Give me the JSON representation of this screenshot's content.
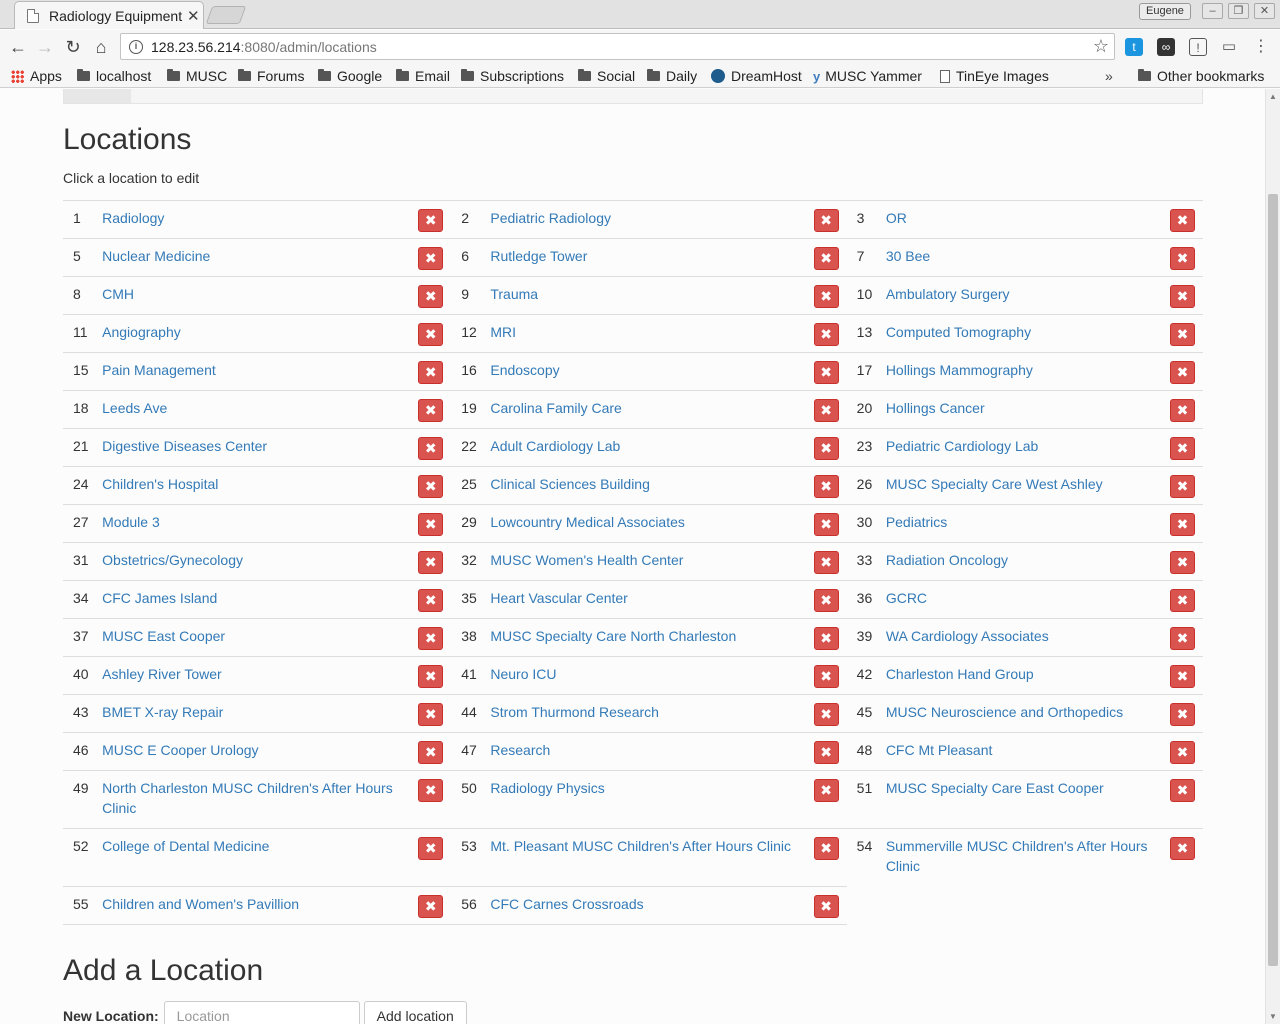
{
  "browser": {
    "tab_title": "Radiology Equipment",
    "profile_name": "Eugene",
    "url_host": "128.23.56.214",
    "url_rest": ":8080/admin/locations",
    "bookmarks": [
      "Apps",
      "localhost",
      "MUSC",
      "Forums",
      "Google",
      "Email",
      "Subscriptions",
      "Social",
      "Daily",
      "DreamHost",
      "MUSC Yammer",
      "TinEye Images"
    ],
    "other_bookmarks": "Other bookmarks",
    "overflow": "»"
  },
  "page": {
    "title": "Locations",
    "subtitle": "Click a location to edit",
    "delete_glyph": "✖",
    "rows": [
      [
        {
          "id": "1",
          "name": "Radiology"
        },
        {
          "id": "2",
          "name": "Pediatric Radiology"
        },
        {
          "id": "3",
          "name": "OR"
        }
      ],
      [
        {
          "id": "5",
          "name": "Nuclear Medicine"
        },
        {
          "id": "6",
          "name": "Rutledge Tower"
        },
        {
          "id": "7",
          "name": "30 Bee"
        }
      ],
      [
        {
          "id": "8",
          "name": "CMH"
        },
        {
          "id": "9",
          "name": "Trauma"
        },
        {
          "id": "10",
          "name": "Ambulatory Surgery"
        }
      ],
      [
        {
          "id": "11",
          "name": "Angiography"
        },
        {
          "id": "12",
          "name": "MRI"
        },
        {
          "id": "13",
          "name": "Computed Tomography"
        }
      ],
      [
        {
          "id": "15",
          "name": "Pain Management"
        },
        {
          "id": "16",
          "name": "Endoscopy"
        },
        {
          "id": "17",
          "name": "Hollings Mammography"
        }
      ],
      [
        {
          "id": "18",
          "name": "Leeds Ave"
        },
        {
          "id": "19",
          "name": "Carolina Family Care"
        },
        {
          "id": "20",
          "name": "Hollings Cancer"
        }
      ],
      [
        {
          "id": "21",
          "name": "Digestive Diseases Center"
        },
        {
          "id": "22",
          "name": "Adult Cardiology Lab"
        },
        {
          "id": "23",
          "name": "Pediatric Cardiology Lab"
        }
      ],
      [
        {
          "id": "24",
          "name": "Children's Hospital"
        },
        {
          "id": "25",
          "name": "Clinical Sciences Building"
        },
        {
          "id": "26",
          "name": "MUSC Specialty Care West Ashley"
        }
      ],
      [
        {
          "id": "27",
          "name": "Module 3"
        },
        {
          "id": "29",
          "name": "Lowcountry Medical Associates"
        },
        {
          "id": "30",
          "name": "Pediatrics"
        }
      ],
      [
        {
          "id": "31",
          "name": "Obstetrics/Gynecology"
        },
        {
          "id": "32",
          "name": "MUSC Women's Health Center"
        },
        {
          "id": "33",
          "name": "Radiation Oncology"
        }
      ],
      [
        {
          "id": "34",
          "name": "CFC James Island"
        },
        {
          "id": "35",
          "name": "Heart Vascular Center"
        },
        {
          "id": "36",
          "name": "GCRC"
        }
      ],
      [
        {
          "id": "37",
          "name": "MUSC East Cooper"
        },
        {
          "id": "38",
          "name": "MUSC Specialty Care North Charleston"
        },
        {
          "id": "39",
          "name": "WA Cardiology Associates"
        }
      ],
      [
        {
          "id": "40",
          "name": "Ashley River Tower"
        },
        {
          "id": "41",
          "name": "Neuro ICU"
        },
        {
          "id": "42",
          "name": "Charleston Hand Group"
        }
      ],
      [
        {
          "id": "43",
          "name": "BMET X-ray Repair"
        },
        {
          "id": "44",
          "name": "Strom Thurmond Research"
        },
        {
          "id": "45",
          "name": "MUSC Neuroscience and Orthopedics"
        }
      ],
      [
        {
          "id": "46",
          "name": "MUSC E Cooper Urology"
        },
        {
          "id": "47",
          "name": "Research"
        },
        {
          "id": "48",
          "name": "CFC Mt Pleasant"
        }
      ],
      [
        {
          "id": "49",
          "name": "North Charleston MUSC Children's After Hours Clinic"
        },
        {
          "id": "50",
          "name": "Radiology Physics"
        },
        {
          "id": "51",
          "name": "MUSC Specialty Care East Cooper"
        }
      ],
      [
        {
          "id": "52",
          "name": "College of Dental Medicine"
        },
        {
          "id": "53",
          "name": "Mt. Pleasant MUSC Children's After Hours Clinic"
        },
        {
          "id": "54",
          "name": "Summerville MUSC Children's After Hours Clinic"
        }
      ],
      [
        {
          "id": "55",
          "name": "Children and Women's Pavillion"
        },
        {
          "id": "56",
          "name": "CFC Carnes Crossroads"
        }
      ]
    ],
    "add_title": "Add a Location",
    "add_label": "New Location:",
    "add_placeholder": "Location",
    "add_button": "Add location"
  }
}
